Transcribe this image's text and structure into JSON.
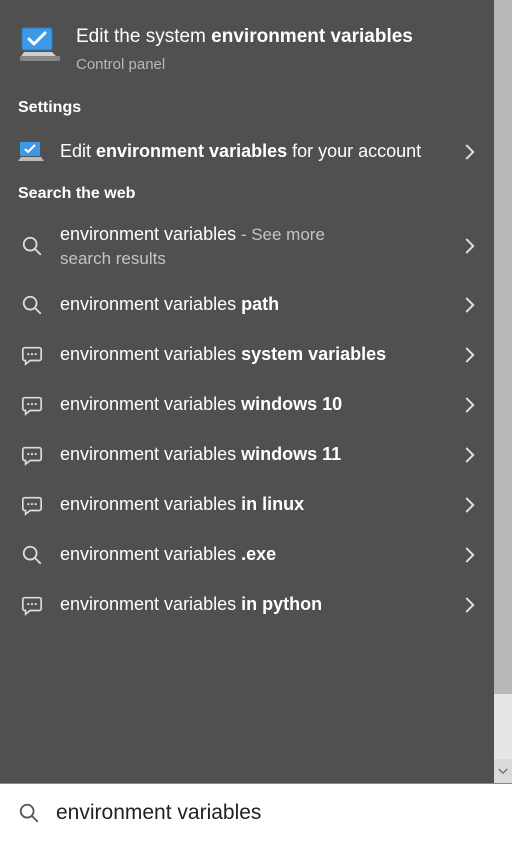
{
  "bestMatch": {
    "titlePre": "Edit the system ",
    "titleBold": "environment variables",
    "subtitle": "Control panel"
  },
  "sections": {
    "settings": "Settings",
    "web": "Search the web"
  },
  "settingsItem": {
    "pre": "Edit ",
    "bold": "environment variables",
    "post": " for your account"
  },
  "webResults": [
    {
      "icon": "search",
      "base": "environment variables",
      "bold": "",
      "suffix": " - See more",
      "subline": "search results"
    },
    {
      "icon": "search",
      "base": "environment variables ",
      "bold": "path",
      "suffix": "",
      "subline": ""
    },
    {
      "icon": "chat",
      "base": "environment variables ",
      "bold": "system variables",
      "suffix": "",
      "subline": ""
    },
    {
      "icon": "chat",
      "base": "environment variables ",
      "bold": "windows 10",
      "suffix": "",
      "subline": ""
    },
    {
      "icon": "chat",
      "base": "environment variables ",
      "bold": "windows 11",
      "suffix": "",
      "subline": ""
    },
    {
      "icon": "chat",
      "base": "environment variables ",
      "bold": "in linux",
      "suffix": "",
      "subline": ""
    },
    {
      "icon": "search",
      "base": "environment variables ",
      "bold": ".exe",
      "suffix": "",
      "subline": ""
    },
    {
      "icon": "chat",
      "base": "environment variables ",
      "bold": "in python",
      "suffix": "",
      "subline": ""
    }
  ],
  "search": {
    "value": "environment variables"
  }
}
